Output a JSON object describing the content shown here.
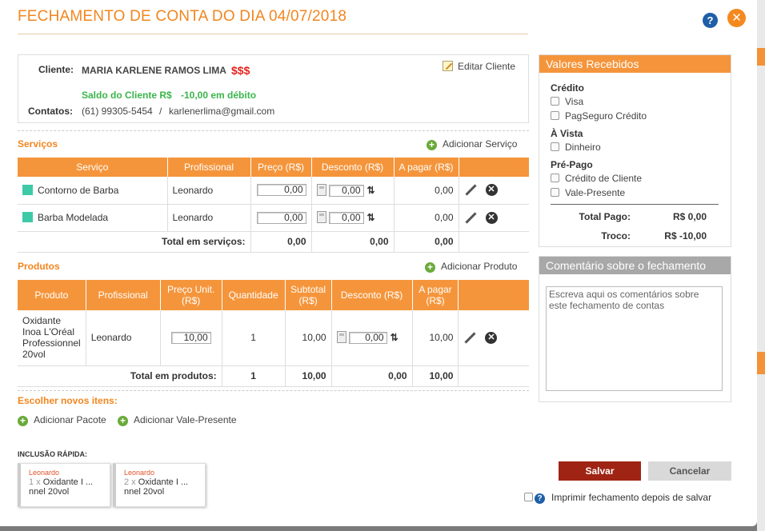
{
  "modal": {
    "title": "FECHAMENTO DE CONTA DO DIA 04/07/2018"
  },
  "colors": {
    "accent": "#f5953b",
    "title": "#f2861e",
    "save": "#9f2414",
    "money": "#e52420",
    "balance": "#3ab54a"
  },
  "client": {
    "client_label": "Cliente:",
    "name": "MARIA KARLENE RAMOS LIMA",
    "money_badge": "$$$",
    "edit_label": "Editar Cliente",
    "balance_label": "Saldo do Cliente R$",
    "balance_value": "-10,00 em débito",
    "contacts_label": "Contatos:",
    "phone": "(61) 99305-5454",
    "separator": "/",
    "email": "karlenerlima@gmail.com"
  },
  "services": {
    "heading": "Serviços",
    "add_label": "Adicionar Serviço",
    "columns": [
      "Serviço",
      "Profissional",
      "Preço (R$)",
      "Desconto (R$)",
      "A pagar (R$)"
    ],
    "rows": [
      {
        "service": "Contorno de Barba",
        "professional": "Leonardo",
        "price": "0,00",
        "discount": "0,00",
        "to_pay": "0,00"
      },
      {
        "service": "Barba Modelada",
        "professional": "Leonardo",
        "price": "0,00",
        "discount": "0,00",
        "to_pay": "0,00"
      }
    ],
    "total_label": "Total em serviços:",
    "total_price": "0,00",
    "total_discount": "0,00",
    "total_to_pay": "0,00"
  },
  "products": {
    "heading": "Produtos",
    "add_label": "Adicionar Produto",
    "columns": [
      "Produto",
      "Profissional",
      "Preço Unit. (R$)",
      "Quantidade",
      "Subtotal (R$)",
      "Desconto (R$)",
      "A pagar (R$)"
    ],
    "rows": [
      {
        "product": "Oxidante Inoa L'Oréal Professionnel 20vol",
        "professional": "Leonardo",
        "unit_price": "10,00",
        "quantity": "1",
        "subtotal": "10,00",
        "discount": "0,00",
        "to_pay": "10,00"
      }
    ],
    "total_label": "Total em produtos:",
    "total_quantity": "1",
    "total_subtotal": "10,00",
    "total_discount": "0,00",
    "total_to_pay": "10,00"
  },
  "new_items": {
    "heading": "Escolher novos itens:",
    "add_package": "Adicionar Pacote",
    "add_voucher": "Adicionar Vale-Presente"
  },
  "quick": {
    "label": "INCLUSÃO RÁPIDA:",
    "cards": [
      {
        "professional": "Leonardo",
        "qty": "1 x",
        "line1": "Oxidante I ...",
        "line2": "nnel 20vol"
      },
      {
        "professional": "Leonardo",
        "qty": "2 x",
        "line1": "Oxidante I ...",
        "line2": "nnel 20vol"
      }
    ]
  },
  "received": {
    "title": "Valores Recebidos",
    "groups": [
      {
        "name": "Crédito",
        "options": [
          "Visa",
          "PagSeguro Crédito"
        ]
      },
      {
        "name": "À Vista",
        "options": [
          "Dinheiro"
        ]
      },
      {
        "name": "Pré-Pago",
        "options": [
          "Crédito de Cliente",
          "Vale-Presente"
        ]
      }
    ],
    "total_paid_label": "Total Pago:",
    "total_paid_value": "R$ 0,00",
    "change_label": "Troco:",
    "change_value": "R$ -10,00"
  },
  "comment": {
    "title": "Comentário sobre o fechamento",
    "placeholder": "Escreva aqui os comentários sobre este fechamento de contas"
  },
  "actions": {
    "save": "Salvar",
    "cancel": "Cancelar",
    "print_label": "Imprimir fechamento depois de salvar"
  },
  "icons": {
    "help": "?",
    "close": "✕",
    "plus": "+",
    "remove": "✕",
    "sort": "⇅"
  }
}
